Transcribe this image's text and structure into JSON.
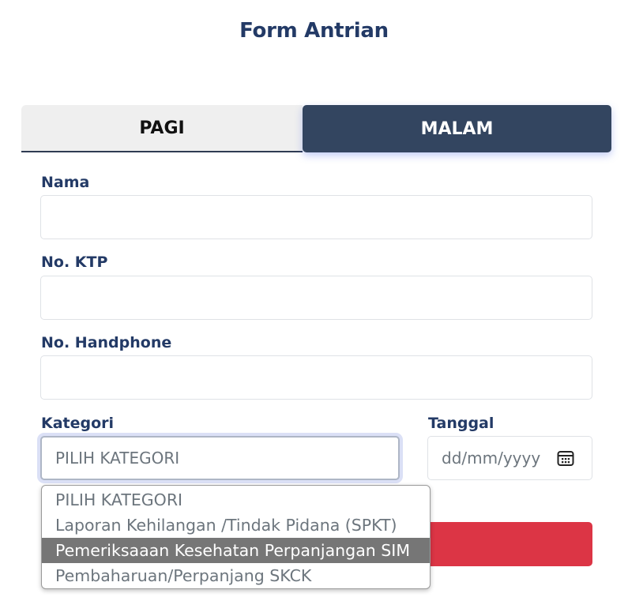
{
  "page": {
    "title": "Form Antrian"
  },
  "tabs": [
    {
      "label": "PAGI",
      "active": false
    },
    {
      "label": "MALAM",
      "active": true
    }
  ],
  "form": {
    "nama": {
      "label": "Nama",
      "value": ""
    },
    "ktp": {
      "label": "No. KTP",
      "value": ""
    },
    "handphone": {
      "label": "No. Handphone",
      "value": ""
    },
    "kategori": {
      "label": "Kategori",
      "selected": "PILIH KATEGORI"
    },
    "tanggal": {
      "label": "Tanggal",
      "placeholder": "dd/mm/yyyy",
      "icon": "calendar-icon"
    }
  },
  "dropdown": {
    "options": [
      "PILIH KATEGORI",
      "Laporan Kehilangan /Tindak Pidana (SPKT)",
      "Pemeriksaaan Kesehatan Perpanjangan SIM",
      "Pembaharuan/Perpanjang SKCK"
    ],
    "highlighted_index": 2
  },
  "colors": {
    "title": "#233a66",
    "tab_active_bg": "#334560",
    "tab_inactive_bg": "#efefef",
    "submit": "#dc3545",
    "option_highlight": "#767676"
  }
}
